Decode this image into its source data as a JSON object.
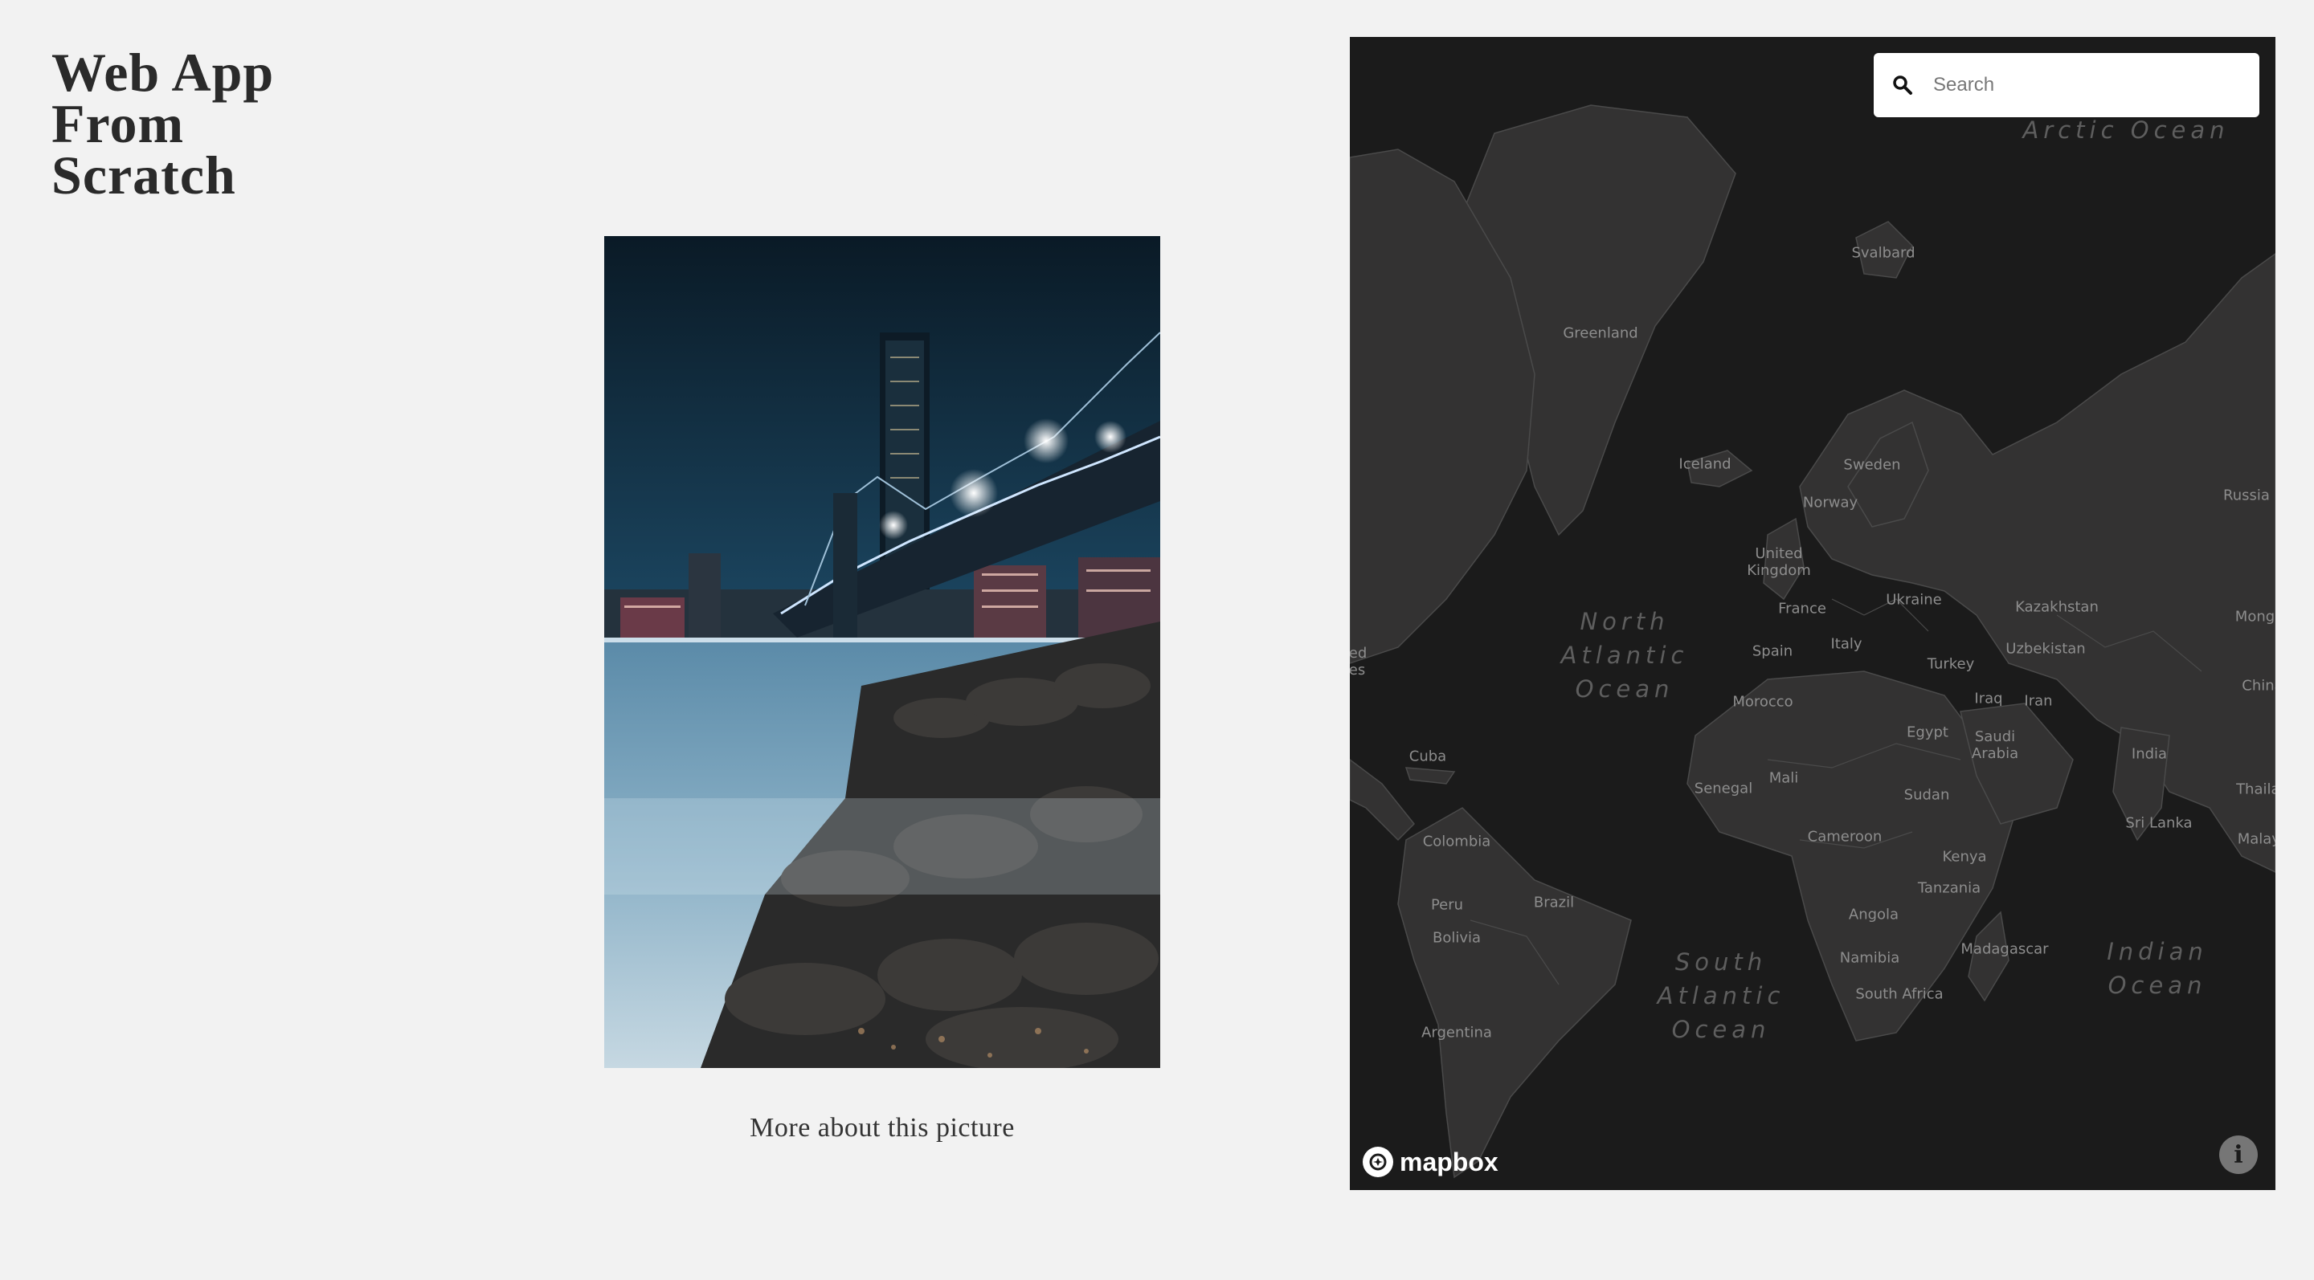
{
  "site": {
    "title_lines": [
      "Web App",
      "From",
      "Scratch"
    ]
  },
  "photo": {
    "caption": "More about this picture"
  },
  "map": {
    "search": {
      "placeholder": "Search",
      "value": ""
    },
    "attribution_logo": "mapbox",
    "info_icon": "i",
    "colors": {
      "background": "#1b1b1b",
      "land": "#333232",
      "border": "#4a4a4a",
      "label": "#8d8d8d",
      "ocean_label": "#5e5e5e"
    },
    "oceans": [
      {
        "name": "arctic-ocean",
        "text": "Arctic Ocean"
      },
      {
        "name": "north-atlantic-ocean",
        "text": "North\nAtlantic\nOcean"
      },
      {
        "name": "south-atlantic-ocean",
        "text": "South\nAtlantic\nOcean"
      },
      {
        "name": "indian-ocean",
        "text": "Indian\nOcean"
      }
    ],
    "places": [
      "Svalbard",
      "Greenland",
      "Iceland",
      "Sweden",
      "Norway",
      "Russia",
      "United\nKingdom",
      "France",
      "Ukraine",
      "Kazakhstan",
      "Mongo",
      "Spain",
      "Italy",
      "Uzbekistan",
      "ed\nes",
      "Turkey",
      "Morocco",
      "Iraq",
      "Iran",
      "China",
      "Egypt",
      "Saudi\nArabia",
      "India",
      "Cuba",
      "Mali",
      "Senegal",
      "Sudan",
      "Thailan",
      "Sri Lanka",
      "Malays",
      "Colombia",
      "Cameroon",
      "Kenya",
      "Tanzania",
      "Peru",
      "Brazil",
      "Angola",
      "Bolivia",
      "Madagascar",
      "Namibia",
      "South Africa",
      "Argentina"
    ]
  }
}
